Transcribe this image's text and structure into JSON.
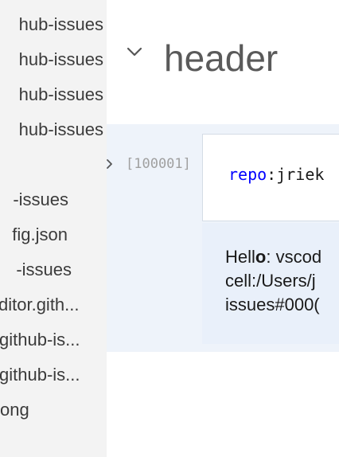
{
  "sidebar": {
    "items": [
      {
        "label": "hub-issues"
      },
      {
        "label": "hub-issues"
      },
      {
        "label": "hub-issues"
      },
      {
        "label": "hub-issues"
      },
      {
        "label": ""
      },
      {
        "label": "-issues"
      },
      {
        "label": "fig.json"
      },
      {
        "label": "-issues"
      },
      {
        "label": "ditor.gith..."
      },
      {
        "label": "github-is..."
      },
      {
        "label": "github-is..."
      },
      {
        "label": "ong"
      }
    ]
  },
  "editor": {
    "header_title": "header",
    "chevron_icon": "chevron-down-icon",
    "cell": {
      "execution_count": "[100001]",
      "code": {
        "key": "repo",
        "separator": ":",
        "value": "jriek"
      },
      "output": {
        "line1_prefix": "Hell",
        "line1_bold": "o",
        "line1_suffix": ": vscod",
        "line2": "cell:/Users/j",
        "line3": "issues#000("
      }
    }
  },
  "colors": {
    "sidebar_bg": "#f3f3f3",
    "cell_bg": "#eef3fa",
    "code_keyword": "#0000ff"
  }
}
